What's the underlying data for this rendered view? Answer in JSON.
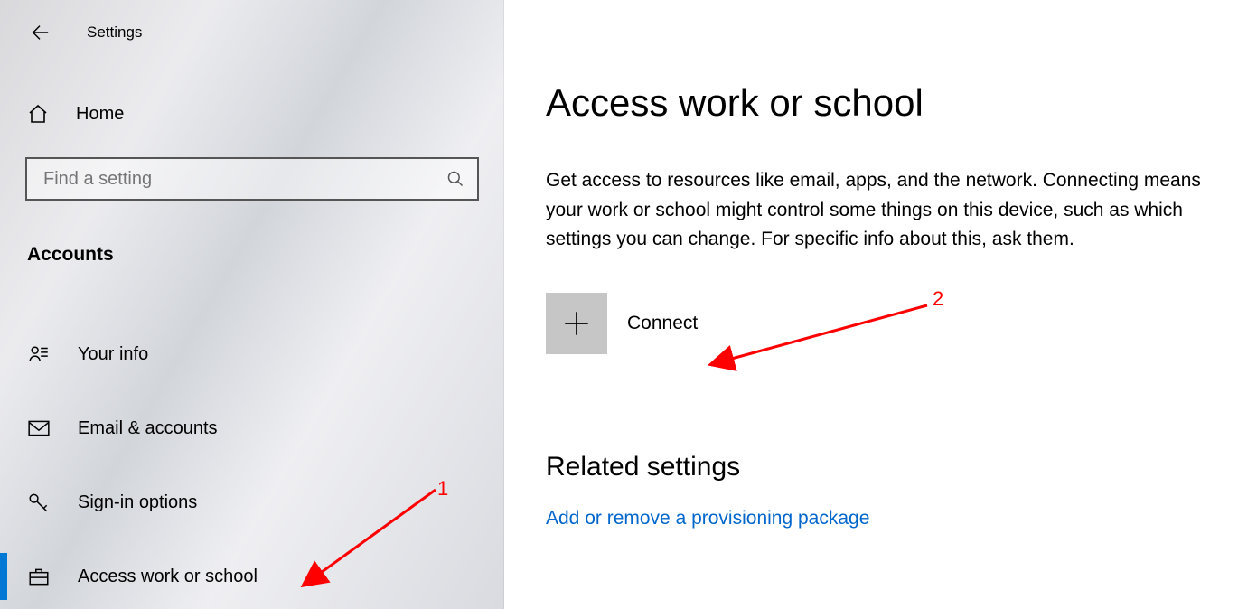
{
  "titlebar": {
    "title": "Settings"
  },
  "sidebar": {
    "home_label": "Home",
    "search_placeholder": "Find a setting",
    "section_label": "Accounts",
    "items": [
      {
        "label": "Your info"
      },
      {
        "label": "Email & accounts"
      },
      {
        "label": "Sign-in options"
      },
      {
        "label": "Access work or school"
      }
    ]
  },
  "main": {
    "title": "Access work or school",
    "description": "Get access to resources like email, apps, and the network. Connecting means your work or school might control some things on this device, such as which settings you can change. For specific info about this, ask them.",
    "connect_label": "Connect",
    "related_header": "Related settings",
    "related_link": "Add or remove a provisioning package"
  },
  "annotations": {
    "a1": "1",
    "a2": "2"
  },
  "colors": {
    "accent": "#0078d4",
    "link": "#0066cc",
    "annotation": "#ff0000"
  }
}
